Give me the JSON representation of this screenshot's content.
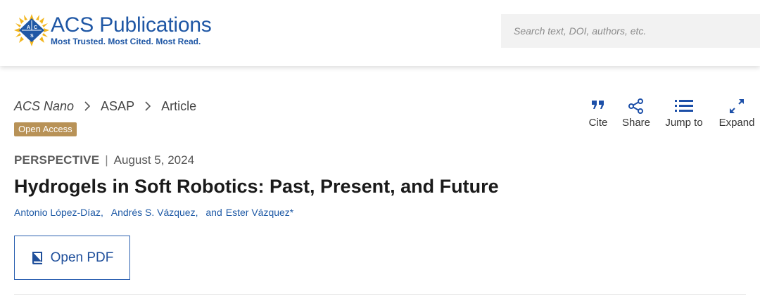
{
  "header": {
    "logo_brand": "ACS",
    "logo_name": "Publications",
    "logo_tagline": "Most Trusted. Most Cited. Most Read.",
    "logo_mark_letters": [
      "A",
      "C",
      "S"
    ],
    "search_placeholder": "Search text, DOI, authors, etc."
  },
  "breadcrumb": {
    "journal": "ACS Nano",
    "section": "ASAP",
    "current": "Article"
  },
  "badge": "Open Access",
  "tools": [
    {
      "label": "Cite",
      "icon": "quote-icon"
    },
    {
      "label": "Share",
      "icon": "share-icon"
    },
    {
      "label": "Jump to",
      "icon": "list-icon"
    },
    {
      "label": "Expand",
      "icon": "expand-icon"
    }
  ],
  "article": {
    "type": "PERSPECTIVE",
    "separator": "|",
    "date": "August 5, 2024",
    "title": "Hydrogels in Soft Robotics: Past, Present, and Future",
    "authors": [
      "Antonio López-Díaz,",
      "Andrés S. Vázquez,",
      "Ester Vázquez*"
    ],
    "authors_conj": "and"
  },
  "pdf_button": {
    "label": "Open PDF",
    "icon": "book-icon"
  },
  "colors": {
    "brand_blue": "#1f57a5",
    "badge_gold": "#b89257",
    "logo_gold": "#f2b51c",
    "link_blue": "#1f5aa6",
    "icon_blue": "#1c4fa8"
  }
}
